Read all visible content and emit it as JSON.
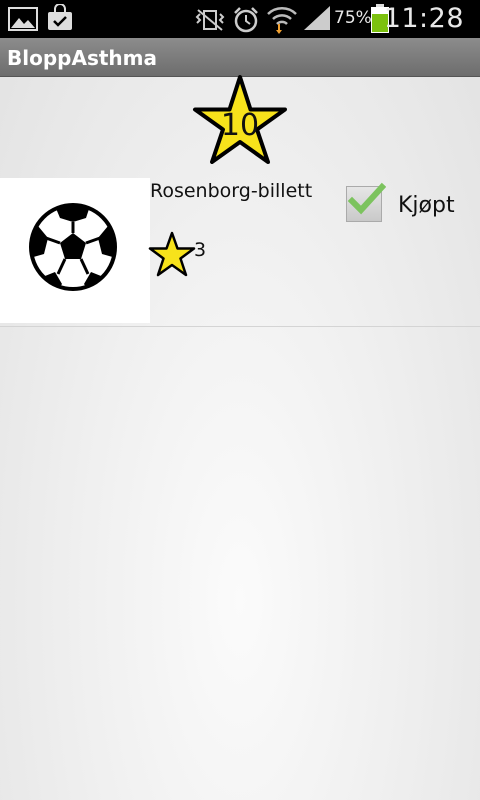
{
  "status_bar": {
    "battery_percent": "75%",
    "time": "11:28",
    "icons": [
      "gallery-icon",
      "shopping-bag-icon",
      "vibrate-mute-icon",
      "alarm-icon",
      "wifi-icon",
      "signal-icon",
      "battery-icon"
    ]
  },
  "app": {
    "title": "BloppAsthma"
  },
  "points": {
    "value": "10"
  },
  "items": [
    {
      "name": "Rosenborg-billett",
      "cost": "3",
      "image": "soccer-ball-icon",
      "purchased_label": "Kjøpt",
      "purchased": true
    }
  ],
  "colors": {
    "star_fill": "#f7e21b",
    "star_outline": "#000000",
    "check_green": "#7cc35e",
    "actionbar": "#7a7a7a"
  }
}
